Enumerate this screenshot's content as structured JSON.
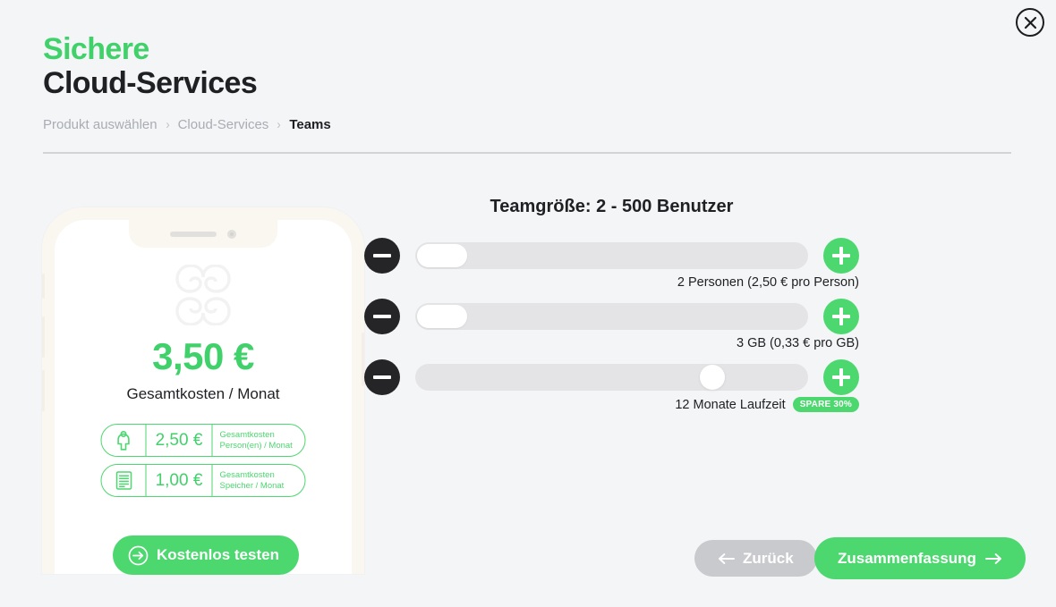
{
  "close": {
    "icon": "close-icon",
    "label": "Schließen"
  },
  "header": {
    "title_line1": "Sichere",
    "title_line2": "Cloud-Services",
    "accent_color": "#41d16a",
    "dark_color": "#1f2023"
  },
  "breadcrumb": {
    "separator": "›",
    "items": [
      {
        "label": "Produkt auswählen",
        "active": false
      },
      {
        "label": "Cloud-Services",
        "active": false
      },
      {
        "label": "Teams",
        "active": true
      }
    ]
  },
  "phone": {
    "logo_icon": "clover-knot-logo-icon",
    "total_price": "3,50 €",
    "total_price_label": "Gesamtkosten / Monat",
    "cost_rows": [
      {
        "icon": "person-icon",
        "amount": "2,50 €",
        "desc_line1": "Gesamtkosten",
        "desc_line2": "Person(en) / Monat"
      },
      {
        "icon": "storage-server-icon",
        "amount": "1,00 €",
        "desc_line1": "Gesamtkosten",
        "desc_line2": "Speicher / Monat"
      }
    ],
    "trial_button": {
      "label": "Kostenlos testen",
      "icon": "arrow-right-circle-icon"
    }
  },
  "configurator": {
    "title": "Teamgröße: 2 - 500 Benutzer",
    "minus_icon": "minus-icon",
    "plus_icon": "plus-icon",
    "sliders": [
      {
        "name": "users",
        "caption": "2 Personen (2,50 € pro Person)",
        "handle_shape": "pill",
        "handle_percent": 0,
        "badge": null
      },
      {
        "name": "storage",
        "caption": "3 GB (0,33 € pro GB)",
        "handle_shape": "pill",
        "handle_percent": 0,
        "badge": null
      },
      {
        "name": "term",
        "caption": "12 Monate Laufzeit",
        "handle_shape": "circle",
        "handle_percent": 73,
        "badge": "SPARE 30%"
      }
    ]
  },
  "footer": {
    "back_button": {
      "label": "Zurück",
      "icon": "arrow-left-icon"
    },
    "summary_button": {
      "label": "Zusammenfassung",
      "icon": "arrow-right-icon"
    }
  }
}
